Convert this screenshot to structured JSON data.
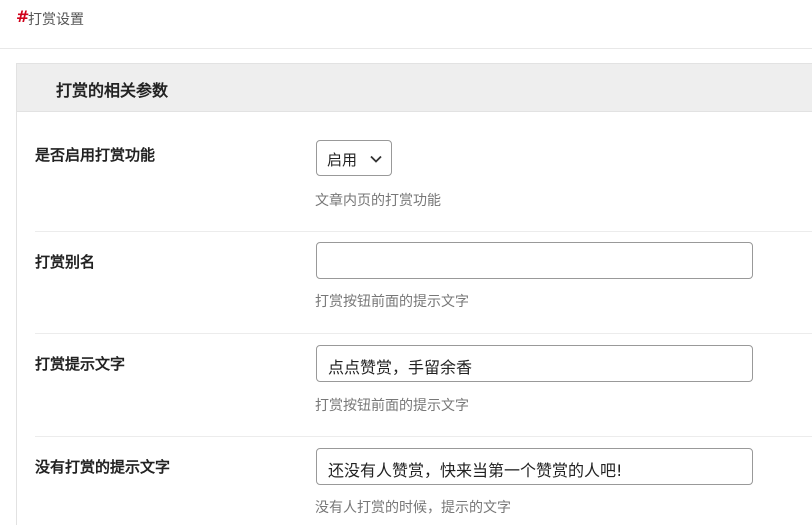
{
  "header": {
    "hash": "#",
    "title": "打赏设置"
  },
  "panel": {
    "title": "打赏的相关参数"
  },
  "fields": [
    {
      "label": "是否启用打赏功能",
      "type": "select",
      "value": "启用",
      "hint": "文章内页的打赏功能"
    },
    {
      "label": "打赏别名",
      "type": "text",
      "value": "",
      "hint": "打赏按钮前面的提示文字"
    },
    {
      "label": "打赏提示文字",
      "type": "text",
      "value": "点点赞赏，手留余香",
      "hint": "打赏按钮前面的提示文字"
    },
    {
      "label": "没有打赏的提示文字",
      "type": "text",
      "value": "还没有人赞赏，快来当第一个赞赏的人吧!",
      "hint": "没有人打赏的时候，提示的文字"
    }
  ],
  "icons": {
    "select_chevron": "chevron-down-icon"
  }
}
